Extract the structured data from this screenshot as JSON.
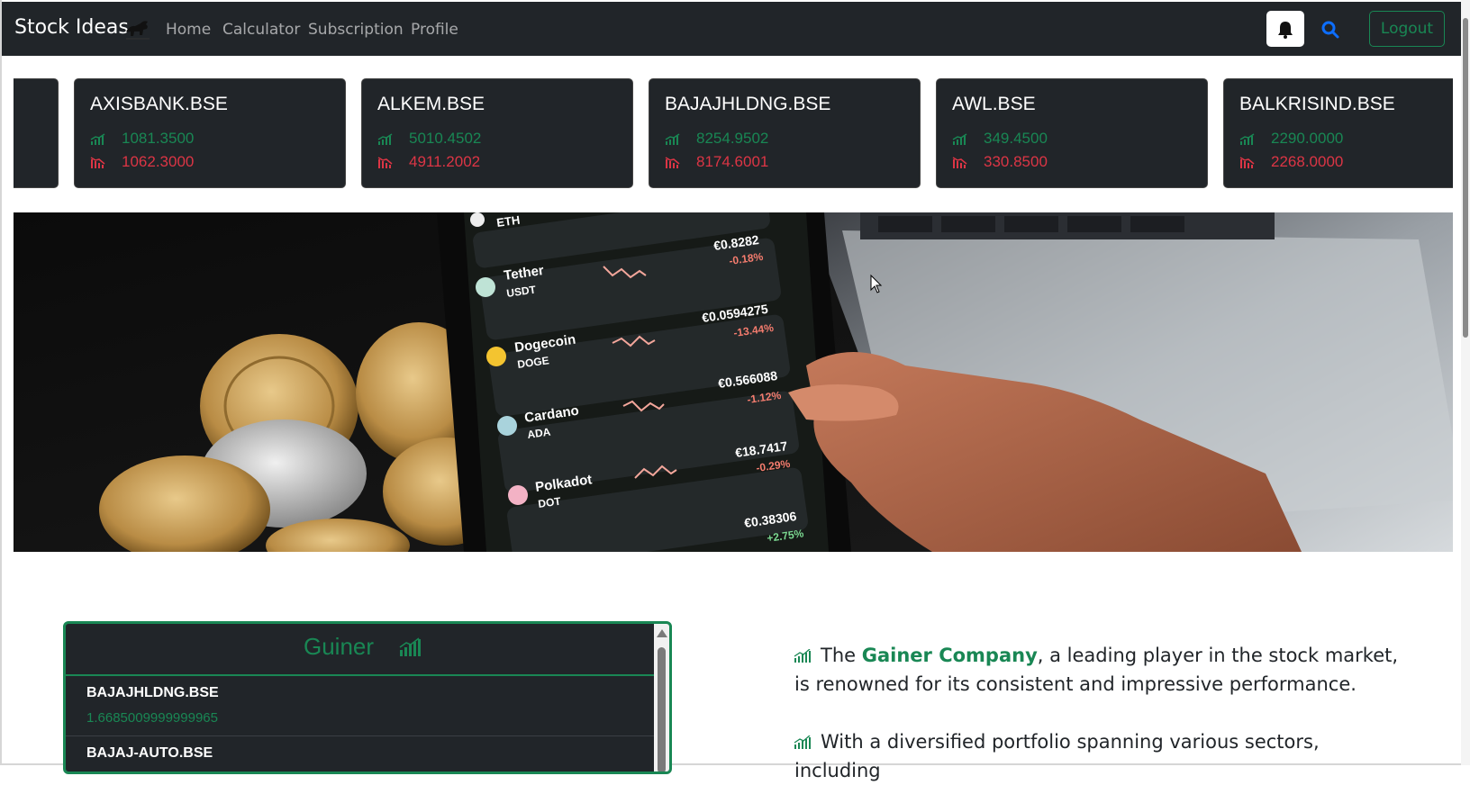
{
  "navbar": {
    "brand": "Stock Ideas",
    "links": [
      "Home",
      "Calculator",
      "Subscription",
      "Profile"
    ],
    "logout_label": "Logout"
  },
  "ticker": [
    {
      "symbol": "AXISBANK.BSE",
      "high": "1081.3500",
      "low": "1062.3000"
    },
    {
      "symbol": "ALKEM.BSE",
      "high": "5010.4502",
      "low": "4911.2002"
    },
    {
      "symbol": "BAJAJHLDNG.BSE",
      "high": "8254.9502",
      "low": "8174.6001"
    },
    {
      "symbol": "AWL.BSE",
      "high": "349.4500",
      "low": "330.8500"
    },
    {
      "symbol": "BALKRISIND.BSE",
      "high": "2290.0000",
      "low": "2268.0000"
    }
  ],
  "hero": {
    "phone_rows": [
      {
        "name": "",
        "code": "ETH",
        "price": "",
        "change": ""
      },
      {
        "name": "Tether",
        "code": "USDT",
        "price": "€0.8282",
        "change": "-0.18%"
      },
      {
        "name": "Dogecoin",
        "code": "DOGE",
        "price": "€0.0594275",
        "change": "-13.44%"
      },
      {
        "name": "Cardano",
        "code": "ADA",
        "price": "€0.566088",
        "change": "-1.12%"
      },
      {
        "name": "Polkadot",
        "code": "DOT",
        "price": "€18.7417",
        "change": "-0.29%"
      },
      {
        "name": "",
        "code": "",
        "price": "€0.38306",
        "change": "+2.75%"
      }
    ]
  },
  "gainer_panel": {
    "title": "Guiner",
    "rows": [
      {
        "symbol": "BAJAJHLDNG.BSE",
        "value": "1.6685009999999965"
      },
      {
        "symbol": "BAJAJ-AUTO.BSE",
        "value": ""
      }
    ]
  },
  "content": {
    "para1_prefix": "The ",
    "para1_highlight": "Gainer Company",
    "para1_suffix": ", a leading player in the stock market, is renowned for its consistent and impressive performance.",
    "para2": "With a diversified portfolio spanning various sectors, including"
  },
  "colors": {
    "navbar_bg": "#212529",
    "green": "#198754",
    "red": "#dc3545",
    "search_blue": "#0d6efd"
  }
}
